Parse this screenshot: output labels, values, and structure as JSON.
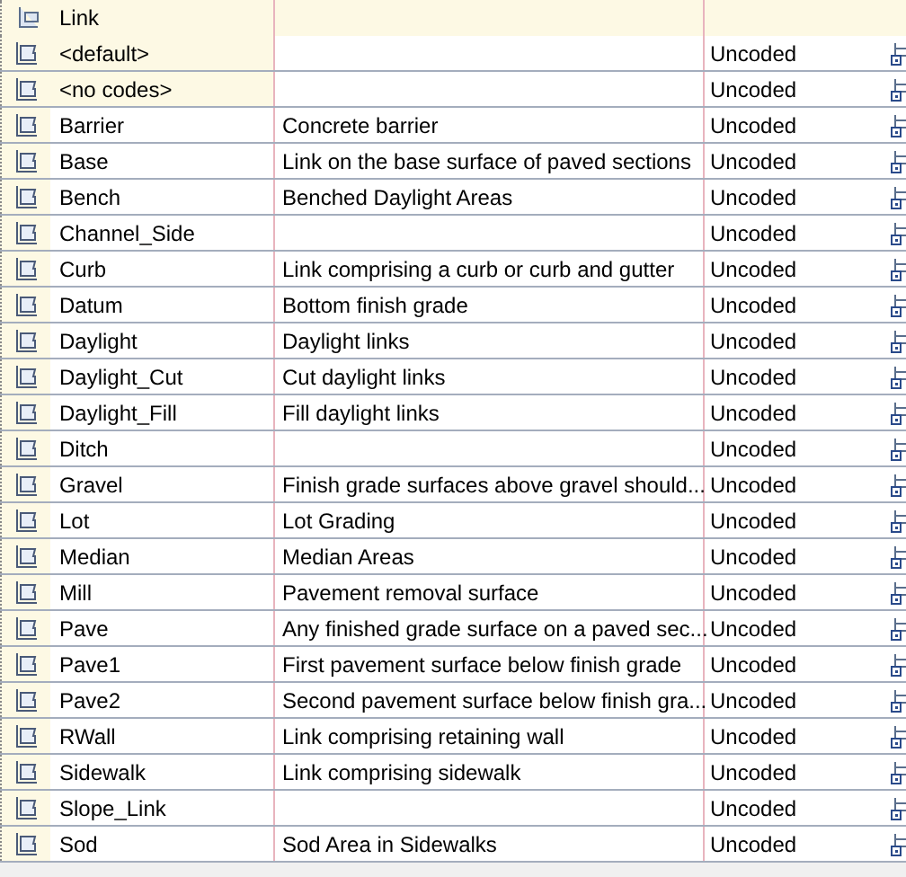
{
  "group": {
    "label": "Link"
  },
  "rows": [
    {
      "kind": "builtin",
      "name": "<default>",
      "description": "",
      "code": "Uncoded"
    },
    {
      "kind": "builtin",
      "name": "<no codes>",
      "description": "",
      "code": "Uncoded"
    },
    {
      "kind": "style",
      "name": "Barrier",
      "description": "Concrete barrier",
      "code": "Uncoded"
    },
    {
      "kind": "style",
      "name": "Base",
      "description": "Link on the base surface of paved sections",
      "code": "Uncoded"
    },
    {
      "kind": "style",
      "name": "Bench",
      "description": "Benched Daylight Areas",
      "code": "Uncoded"
    },
    {
      "kind": "style",
      "name": "Channel_Side",
      "description": "",
      "code": "Uncoded"
    },
    {
      "kind": "style",
      "name": "Curb",
      "description": "Link comprising a curb or curb and gutter",
      "code": "Uncoded"
    },
    {
      "kind": "style",
      "name": "Datum",
      "description": "Bottom finish grade",
      "code": "Uncoded"
    },
    {
      "kind": "style",
      "name": "Daylight",
      "description": "Daylight links",
      "code": "Uncoded"
    },
    {
      "kind": "style",
      "name": "Daylight_Cut",
      "description": "Cut daylight links",
      "code": "Uncoded"
    },
    {
      "kind": "style",
      "name": "Daylight_Fill",
      "description": "Fill daylight links",
      "code": "Uncoded"
    },
    {
      "kind": "style",
      "name": "Ditch",
      "description": "",
      "code": "Uncoded"
    },
    {
      "kind": "style",
      "name": "Gravel",
      "description": "Finish grade surfaces above gravel should...",
      "code": "Uncoded"
    },
    {
      "kind": "style",
      "name": "Lot",
      "description": "Lot Grading",
      "code": "Uncoded"
    },
    {
      "kind": "style",
      "name": "Median",
      "description": "Median Areas",
      "code": "Uncoded"
    },
    {
      "kind": "style",
      "name": "Mill",
      "description": "Pavement removal surface",
      "code": "Uncoded"
    },
    {
      "kind": "style",
      "name": "Pave",
      "description": "Any finished grade surface on a paved sec...",
      "code": "Uncoded"
    },
    {
      "kind": "style",
      "name": "Pave1",
      "description": "First pavement surface below finish grade",
      "code": "Uncoded"
    },
    {
      "kind": "style",
      "name": "Pave2",
      "description": "Second pavement surface below finish gra...",
      "code": "Uncoded"
    },
    {
      "kind": "style",
      "name": "RWall",
      "description": "Link comprising retaining wall",
      "code": "Uncoded"
    },
    {
      "kind": "style",
      "name": "Sidewalk",
      "description": "Link comprising sidewalk",
      "code": "Uncoded"
    },
    {
      "kind": "style",
      "name": "Slope_Link",
      "description": "",
      "code": "Uncoded"
    },
    {
      "kind": "style",
      "name": "Sod",
      "description": "Sod Area in Sidewalks",
      "code": "Uncoded"
    }
  ]
}
